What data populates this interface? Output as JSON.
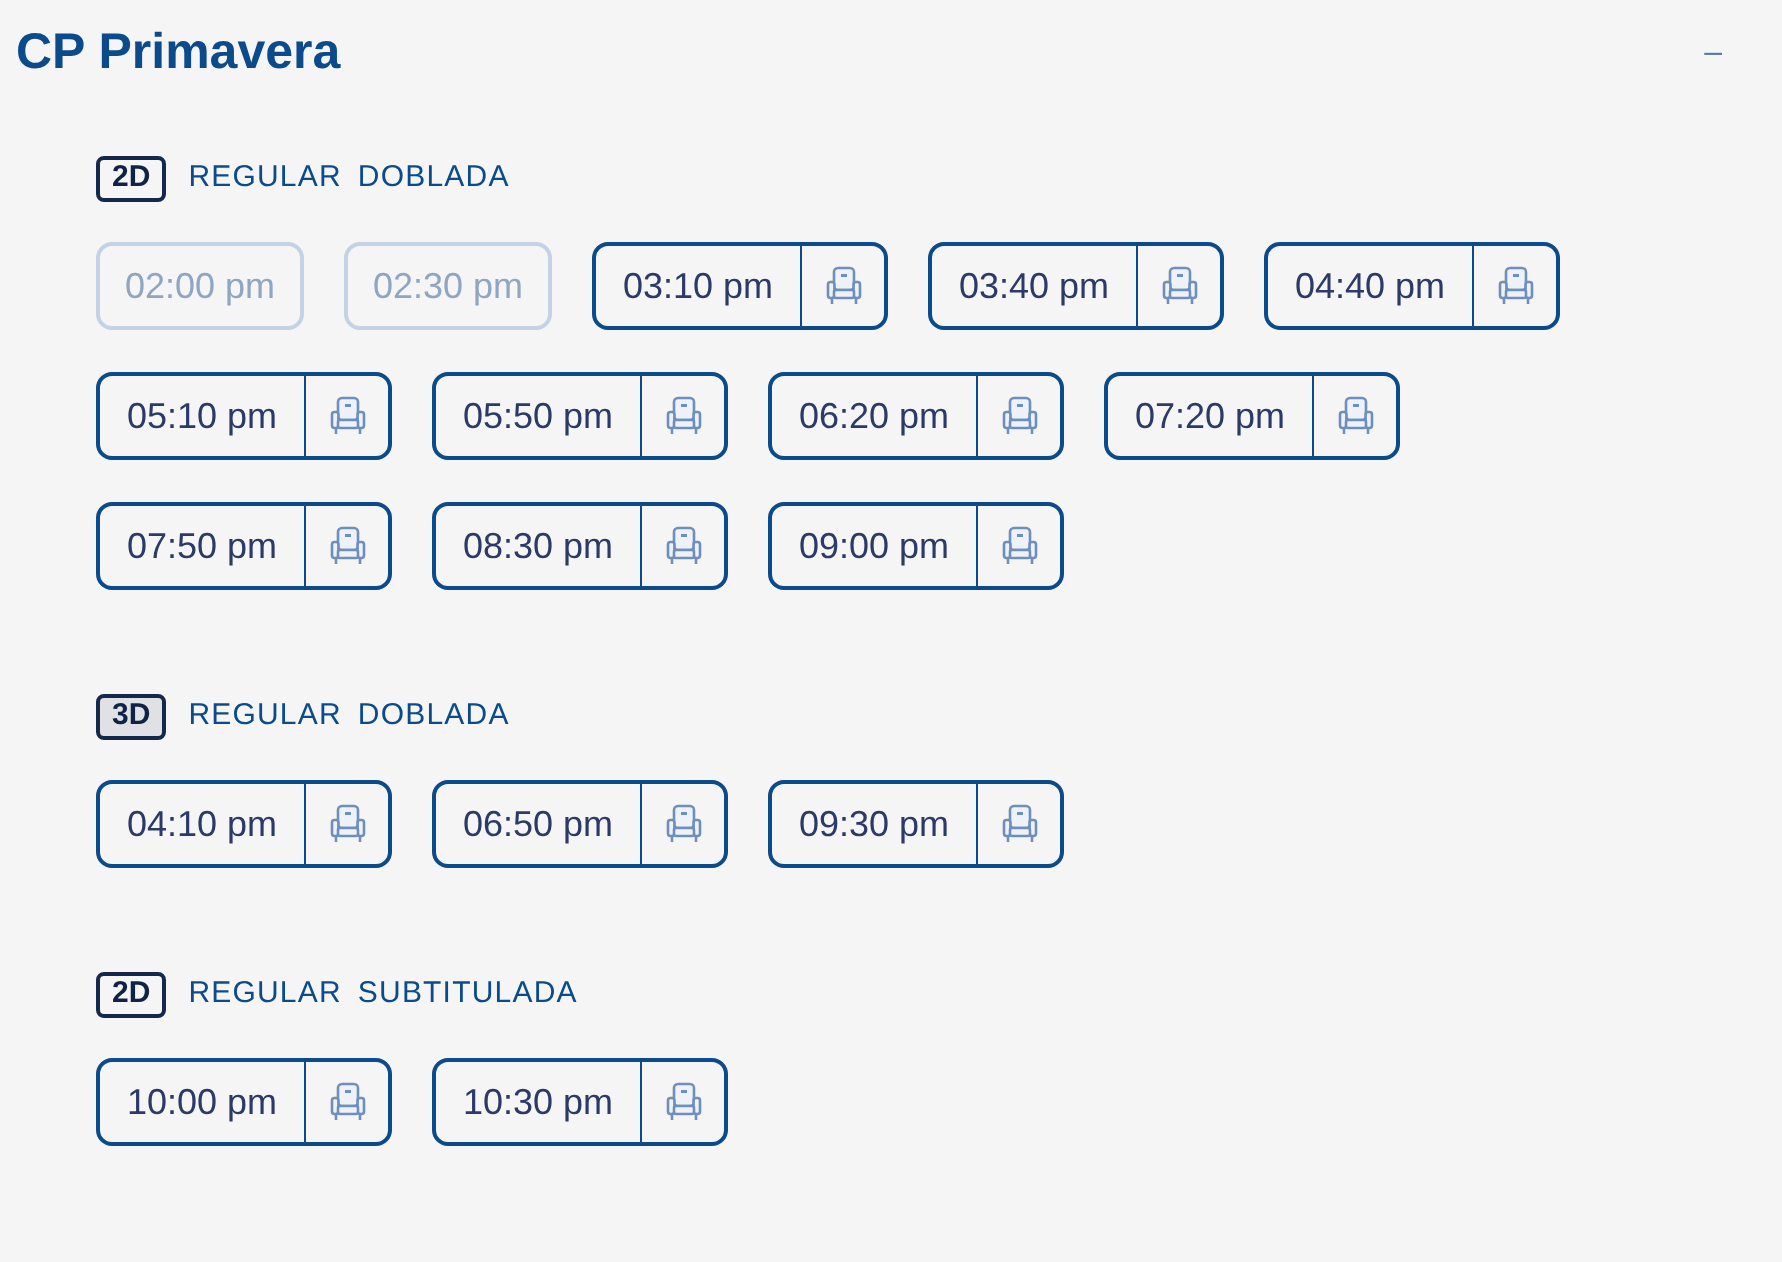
{
  "cinema": {
    "title": "CP Primavera",
    "collapse_button": "–"
  },
  "sections": [
    {
      "format": "2D",
      "kind": "plain",
      "tags": [
        "REGULAR",
        "DOBLADA"
      ],
      "showtimes": [
        {
          "time": "02:00 pm",
          "disabled": true
        },
        {
          "time": "02:30 pm",
          "disabled": true
        },
        {
          "time": "03:10 pm",
          "disabled": false
        },
        {
          "time": "03:40 pm",
          "disabled": false
        },
        {
          "time": "04:40 pm",
          "disabled": false
        },
        {
          "time": "05:10 pm",
          "disabled": false
        },
        {
          "time": "05:50 pm",
          "disabled": false
        },
        {
          "time": "06:20 pm",
          "disabled": false
        },
        {
          "time": "07:20 pm",
          "disabled": false
        },
        {
          "time": "07:50 pm",
          "disabled": false
        },
        {
          "time": "08:30 pm",
          "disabled": false
        },
        {
          "time": "09:00 pm",
          "disabled": false
        }
      ]
    },
    {
      "format": "3D",
      "kind": "shaded",
      "tags": [
        "REGULAR",
        "DOBLADA"
      ],
      "showtimes": [
        {
          "time": "04:10 pm",
          "disabled": false
        },
        {
          "time": "06:50 pm",
          "disabled": false
        },
        {
          "time": "09:30 pm",
          "disabled": false
        }
      ]
    },
    {
      "format": "2D",
      "kind": "plain",
      "tags": [
        "REGULAR",
        "SUBTITULADA"
      ],
      "showtimes": [
        {
          "time": "10:00 pm",
          "disabled": false
        },
        {
          "time": "10:30 pm",
          "disabled": false
        }
      ]
    }
  ]
}
